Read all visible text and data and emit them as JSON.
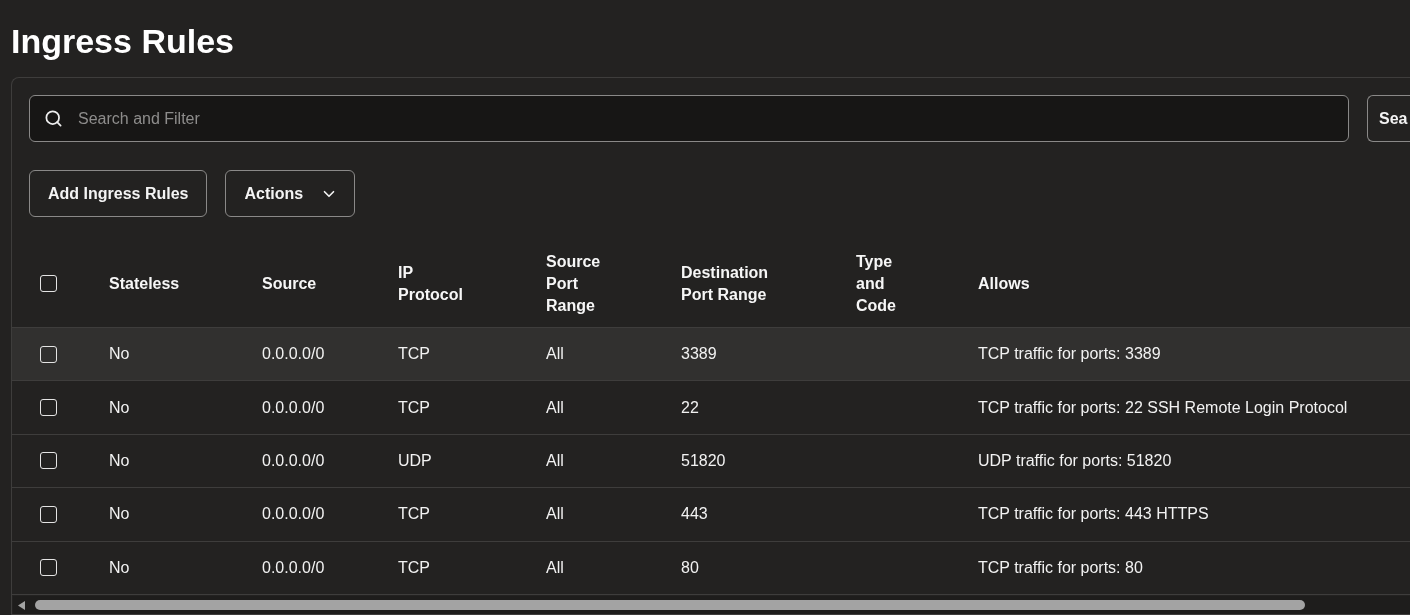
{
  "page": {
    "title": "Ingress Rules"
  },
  "search": {
    "placeholder": "Search and Filter",
    "button_label": "Sea"
  },
  "toolbar": {
    "buttons": [
      {
        "label": "Add Ingress Rules",
        "kind": "plain"
      },
      {
        "label": "Actions",
        "kind": "menu"
      }
    ]
  },
  "table": {
    "select_all": {
      "checked": false
    },
    "columns": [
      "Stateless",
      "Source",
      "IP Protocol",
      "Source Port Range",
      "Destination Port Range",
      "Type and Code",
      "Allows"
    ],
    "rows": [
      {
        "checked": false,
        "highlighted": true,
        "stateless": "No",
        "source": "0.0.0.0/0",
        "ip_protocol": "TCP",
        "source_port_range": "All",
        "destination_port_range": "3389",
        "allows": "TCP traffic for ports: 3389"
      },
      {
        "checked": false,
        "highlighted": false,
        "stateless": "No",
        "source": "0.0.0.0/0",
        "ip_protocol": "TCP",
        "source_port_range": "All",
        "destination_port_range": "22",
        "allows": "TCP traffic for ports: 22 SSH Remote Login Protocol"
      },
      {
        "checked": false,
        "highlighted": false,
        "stateless": "No",
        "source": "0.0.0.0/0",
        "ip_protocol": "UDP",
        "source_port_range": "All",
        "destination_port_range": "51820",
        "allows": "UDP traffic for ports: 51820"
      },
      {
        "checked": false,
        "highlighted": false,
        "stateless": "No",
        "source": "0.0.0.0/0",
        "ip_protocol": "TCP",
        "source_port_range": "All",
        "destination_port_range": "443",
        "allows": "TCP traffic for ports: 443 HTTPS"
      },
      {
        "checked": false,
        "highlighted": false,
        "stateless": "No",
        "source": "0.0.0.0/0",
        "ip_protocol": "TCP",
        "source_port_range": "All",
        "destination_port_range": "80",
        "allows": "TCP traffic for ports: 80"
      }
    ]
  }
}
